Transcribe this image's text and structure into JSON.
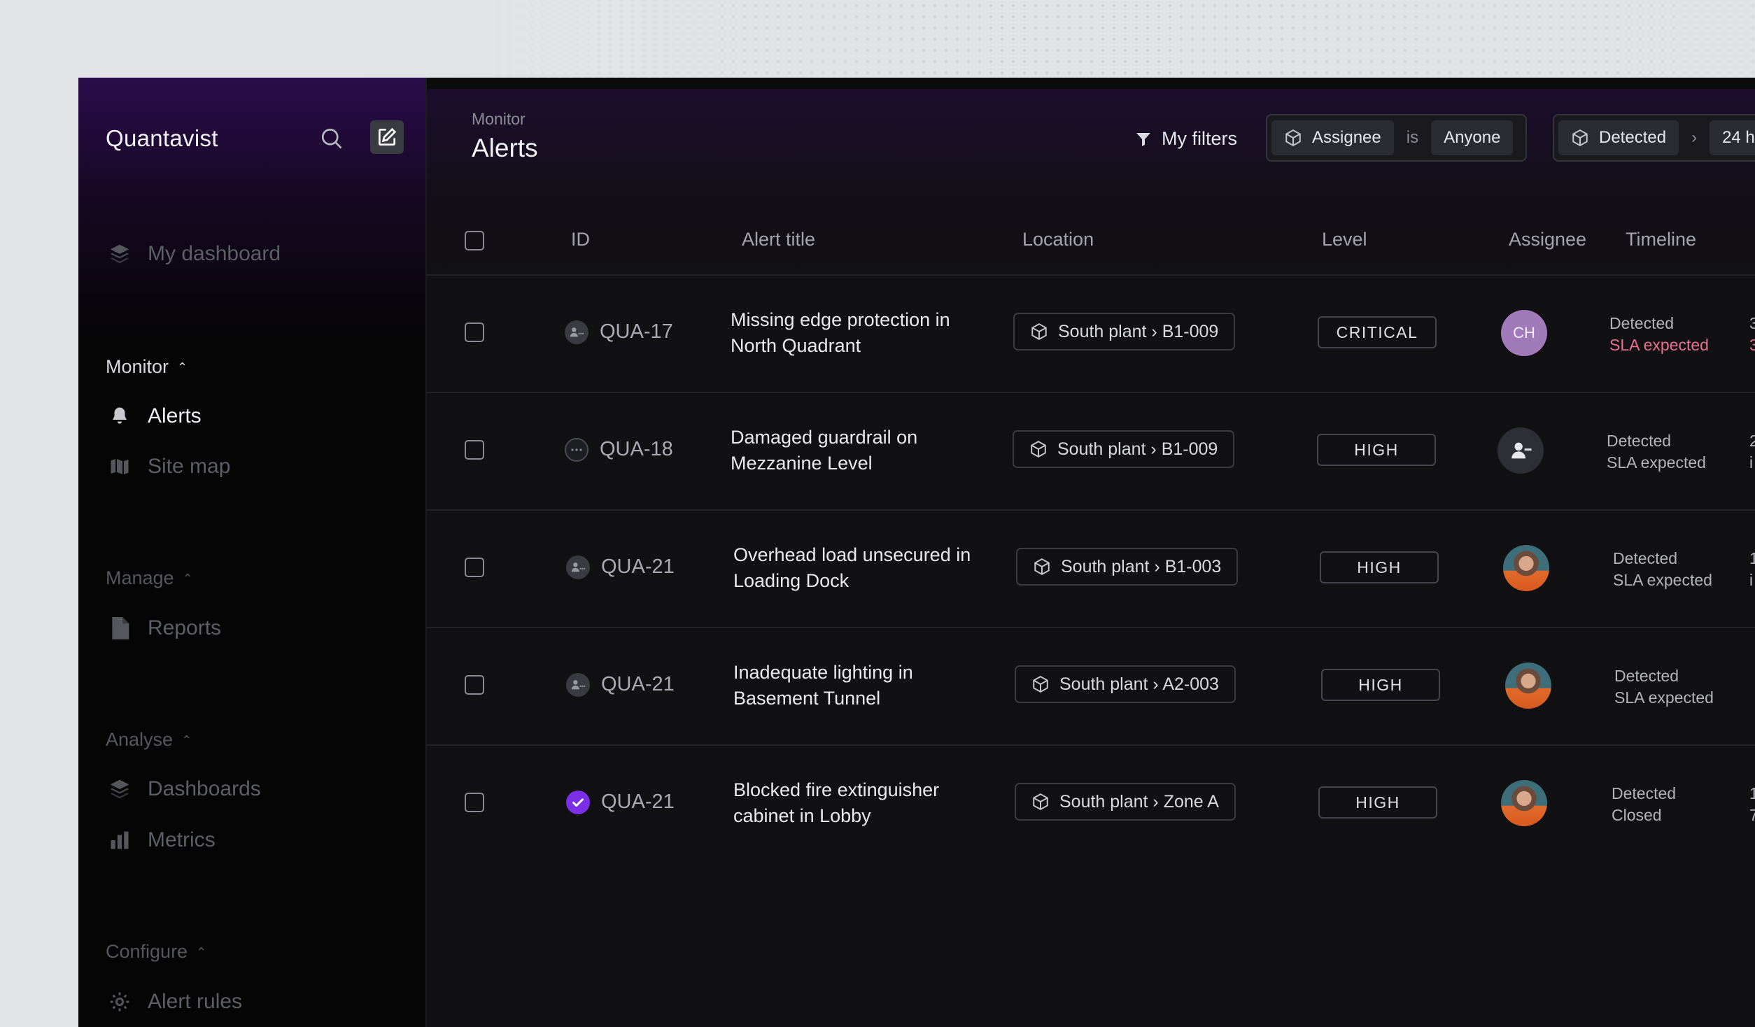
{
  "app": {
    "name": "Quantavist"
  },
  "sidebar": {
    "dashboard_label": "My dashboard",
    "sections": {
      "monitor": "Monitor",
      "manage": "Manage",
      "analyse": "Analyse",
      "configure": "Configure"
    },
    "items": {
      "alerts": "Alerts",
      "site_map": "Site map",
      "reports": "Reports",
      "dashboards": "Dashboards",
      "metrics": "Metrics",
      "alert_rules": "Alert rules"
    },
    "active_item": "Alerts"
  },
  "header": {
    "breadcrumb": "Monitor",
    "title": "Alerts",
    "my_filters": "My filters",
    "filters": [
      {
        "field": "Assignee",
        "operator": "is",
        "value": "Anyone"
      },
      {
        "field": "Detected",
        "operator": "›",
        "value": "24 h"
      }
    ]
  },
  "table": {
    "columns": [
      "ID",
      "Alert title",
      "Location",
      "Level",
      "Assignee",
      "Timeline"
    ],
    "rows": [
      {
        "id": "QUA-17",
        "title": "Missing edge protection in North Quadrant",
        "location": "South plant › B1-009",
        "level": "CRITICAL",
        "assignee": "CH",
        "assignee_type": "initials",
        "timeline": [
          "Detected",
          "SLA expected"
        ],
        "timeline_alert": true,
        "edge": [
          "3",
          "3"
        ],
        "status": "assigned"
      },
      {
        "id": "QUA-18",
        "title": "Damaged guardrail on Mezzanine Level",
        "location": "South plant › B1-009",
        "level": "HIGH",
        "assignee": "",
        "assignee_type": "unassigned",
        "timeline": [
          "Detected",
          "SLA expected"
        ],
        "timeline_alert": false,
        "edge": [
          "2",
          "i"
        ],
        "status": "unassigned"
      },
      {
        "id": "QUA-21",
        "title": "Overhead load unsecured in Loading Dock",
        "location": "South plant › B1-003",
        "level": "HIGH",
        "assignee": "",
        "assignee_type": "photo",
        "timeline": [
          "Detected",
          "SLA expected"
        ],
        "timeline_alert": false,
        "edge": [
          "1",
          "i"
        ],
        "status": "assigned"
      },
      {
        "id": "QUA-21",
        "title": "Inadequate lighting in Basement Tunnel",
        "location": "South plant › A2-003",
        "level": "HIGH",
        "assignee": "",
        "assignee_type": "photo",
        "timeline": [
          "Detected",
          "SLA expected"
        ],
        "timeline_alert": false,
        "edge": [
          "",
          ""
        ],
        "status": "assigned"
      },
      {
        "id": "QUA-21",
        "title": "Blocked fire extinguisher cabinet in Lobby",
        "location": "South plant › Zone A",
        "level": "HIGH",
        "assignee": "",
        "assignee_type": "photo",
        "timeline": [
          "Detected",
          "Closed"
        ],
        "timeline_alert": false,
        "edge": [
          "1",
          "7"
        ],
        "status": "done"
      }
    ]
  },
  "colors": {
    "accent": "#7b2fe6",
    "sla_alert": "#e8708f",
    "sidebar_gradient_top": "#2a0c4b"
  }
}
